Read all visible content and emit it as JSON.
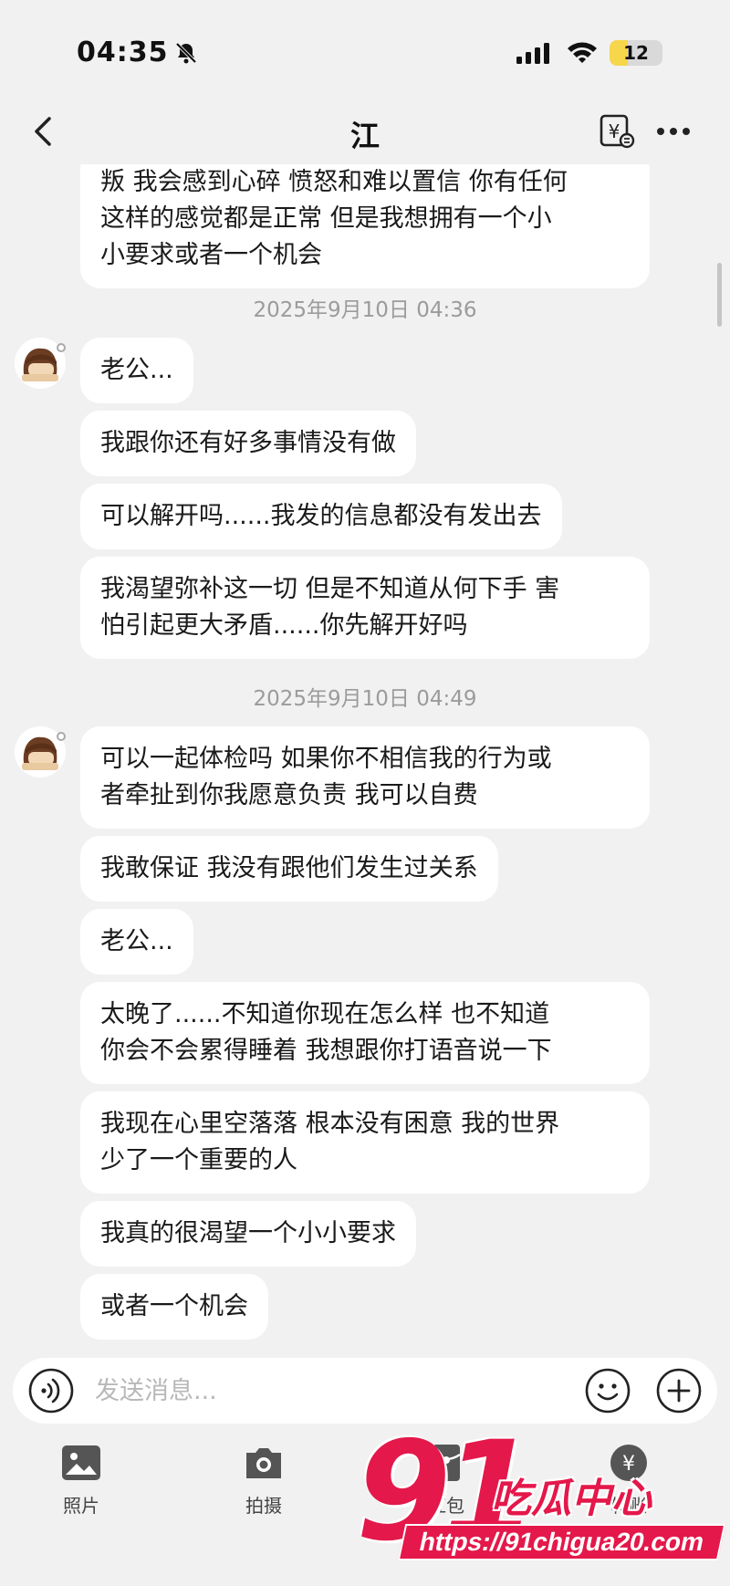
{
  "status_bar": {
    "time": "04:35",
    "battery": "12",
    "battery_level": 0.12
  },
  "header": {
    "title": "江"
  },
  "chat": {
    "top_bubble": "叛 我会感到心碎 愤怒和难以置信 你有任何\n这样的感觉都是正常 但是我想拥有一个小\n小要求或者一个机会",
    "timestamp_1": "2025年9月10日 04:36",
    "group_1": [
      "老公...",
      "我跟你还有好多事情没有做",
      "可以解开吗......我发的信息都没有发出去",
      "我渴望弥补这一切 但是不知道从何下手 害\n怕引起更大矛盾......你先解开好吗"
    ],
    "timestamp_2": "2025年9月10日 04:49",
    "group_2": [
      "可以一起体检吗 如果你不相信我的行为或\n者牵扯到你我愿意负责 我可以自费",
      "我敢保证 我没有跟他们发生过关系",
      "老公...",
      "太晚了......不知道你现在怎么样 也不知道\n你会不会累得睡着 我想跟你打语音说一下",
      "我现在心里空落落 根本没有困意 我的世界\n少了一个重要的人",
      "我真的很渴望一个小小要求",
      "或者一个机会"
    ]
  },
  "input": {
    "placeholder": "发送消息...",
    "value": ""
  },
  "toolbar": {
    "photos": "照片",
    "camera": "拍摄",
    "redpacket": "红包",
    "transfer": "转账"
  },
  "watermark": {
    "brand_number": "91",
    "brand_name": "吃瓜中心",
    "url": "https://91chigua20.com"
  },
  "colors": {
    "background": "#f1f1f1",
    "bubble": "#ffffff",
    "watermark": "#e4184a",
    "battery": "#f6d64a"
  }
}
